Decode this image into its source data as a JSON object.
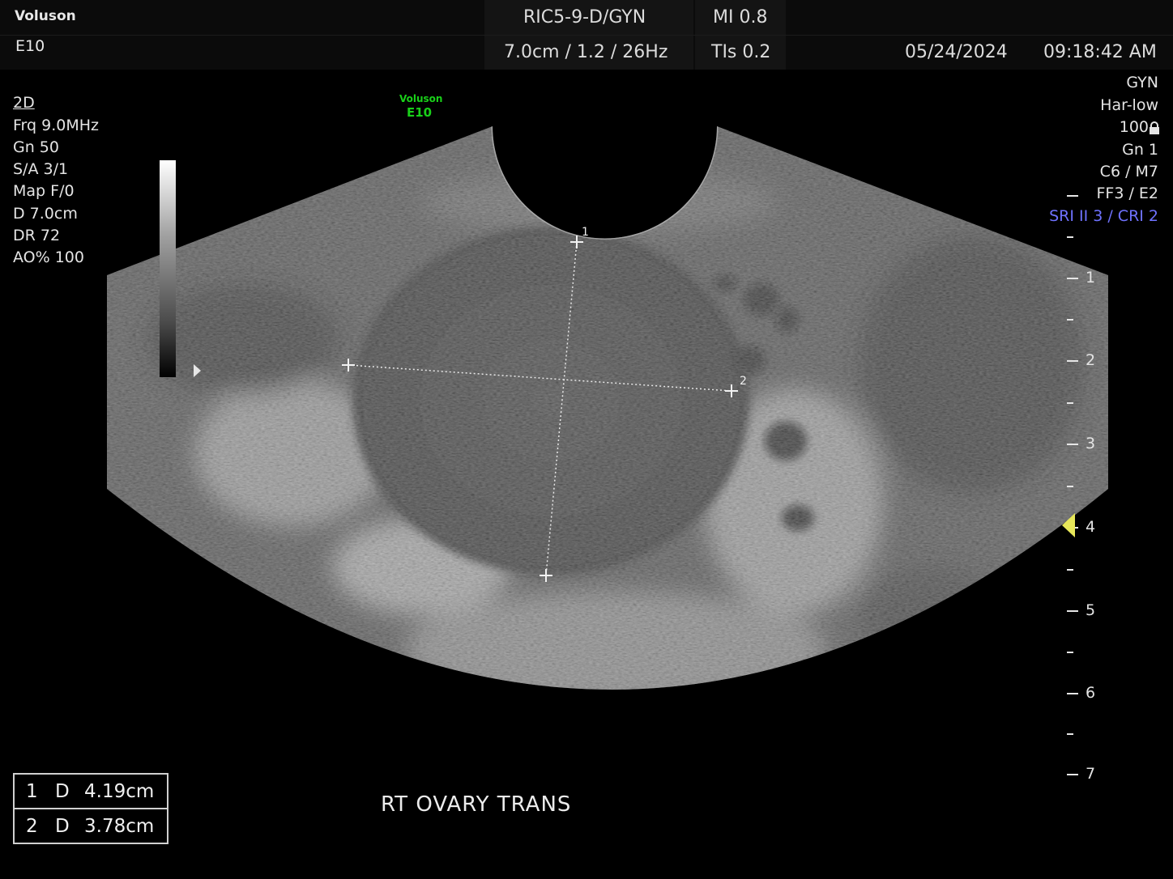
{
  "header": {
    "brand_line1": "Voluson",
    "brand_line2": "E10",
    "probe": "RIC5-9-D/GYN",
    "mi": "MI  0.8",
    "params": "7.0cm / 1.2 / 26Hz",
    "tis": "TIs  0.2",
    "date": "05/24/2024",
    "time": "09:18:42 AM"
  },
  "left_panel": {
    "mode": "2D",
    "lines": [
      "Frq  9.0MHz",
      "Gn  50",
      "S/A  3/1",
      "Map  F/0",
      "D   7.0cm",
      "DR  72",
      "AO%  100"
    ]
  },
  "watermark": {
    "line1": "Voluson",
    "line2": "E10"
  },
  "right_panel": {
    "lines": [
      "GYN",
      "Har-low",
      "100",
      "Gn   1",
      "C6 / M7",
      "FF3 / E2"
    ],
    "sri": "SRI II 3 / CRI 2",
    "lock_icon": "lock-icon"
  },
  "depth_scale": {
    "labels": [
      "1",
      "2",
      "3",
      "4",
      "5",
      "6",
      "7"
    ],
    "unit": "cm"
  },
  "calipers": {
    "point_labels": [
      "1",
      "2"
    ]
  },
  "measurements": [
    {
      "index": "1",
      "type": "D",
      "value": "4.19cm"
    },
    {
      "index": "2",
      "type": "D",
      "value": "3.78cm"
    }
  ],
  "annotation": "RT  OVARY  TRANS",
  "colors": {
    "watermark": "#19d019",
    "sri_text": "#6f72ff",
    "focus_marker": "#e8e85a"
  }
}
